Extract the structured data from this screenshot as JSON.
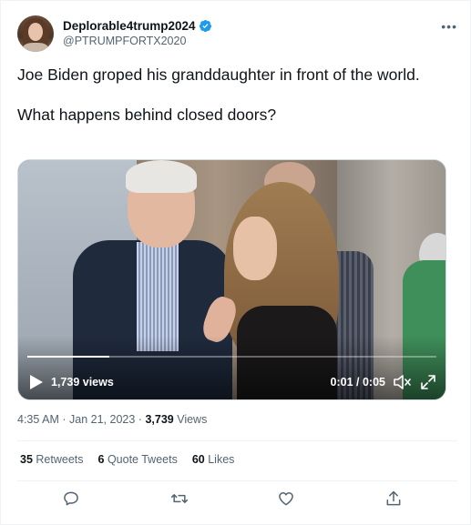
{
  "tweet": {
    "author": {
      "display_name": "Deplorable4trump2024",
      "handle": "@PTRUMPFORTX2020",
      "verified": true
    },
    "more_icon": "more-horizontal-icon",
    "text_line1": "Joe Biden groped his granddaughter in front of the world.",
    "text_line2": "What happens behind closed doors?",
    "video": {
      "views": "1,739 views",
      "time": "0:01 / 0:05",
      "progress_fraction": 0.2
    },
    "meta": {
      "time": "4:35 AM",
      "sep1": "·",
      "date": "Jan 21, 2023",
      "sep2": "·",
      "views_count": "3,739",
      "views_label": "Views"
    },
    "stats": {
      "retweets_count": "35",
      "retweets_label": "Retweets",
      "quotes_count": "6",
      "quotes_label": "Quote Tweets",
      "likes_count": "60",
      "likes_label": "Likes"
    }
  },
  "colors": {
    "text": "#0f1419",
    "secondary": "#536471",
    "verified": "#1d9bf0",
    "divider": "#eff3f4"
  }
}
